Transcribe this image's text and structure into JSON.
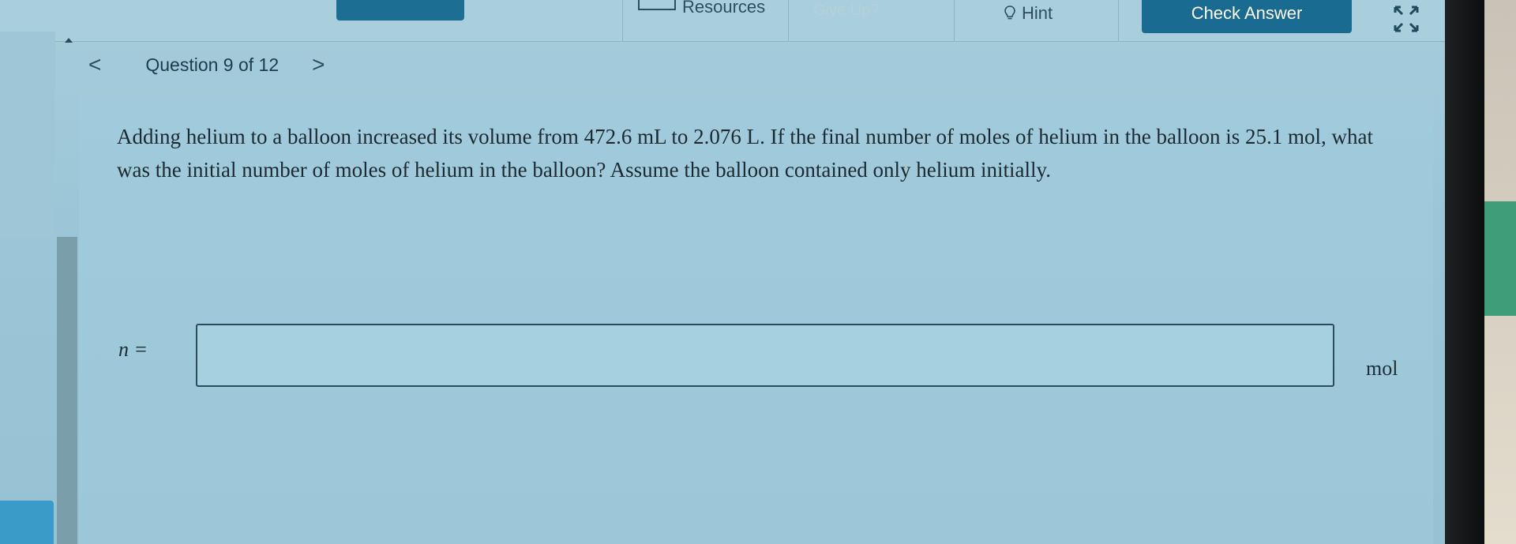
{
  "toolbar": {
    "resources_label": "Resources",
    "give_up_label": "Give Up?",
    "hint_label": "Hint",
    "check_answer_label": "Check Answer"
  },
  "nav": {
    "question_label": "Question 9 of 12",
    "prev_symbol": "<",
    "next_symbol": ">"
  },
  "question": {
    "text": "Adding helium to a balloon increased its volume from 472.6 mL to 2.076 L. If the final number of moles of helium in the balloon is 25.1 mol, what was the initial number of moles of helium in the balloon? Assume the balloon contained only helium initially."
  },
  "answer": {
    "variable_label": "n =",
    "value": "",
    "unit": "mol"
  },
  "colors": {
    "accent": "#1a6b92",
    "background": "#9cc6d7"
  }
}
